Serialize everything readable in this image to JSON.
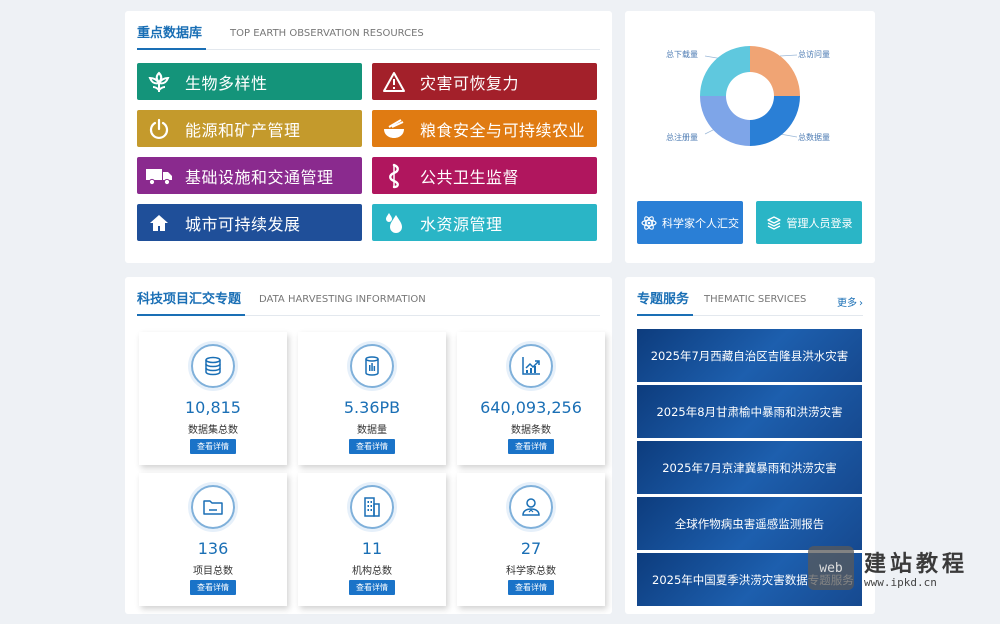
{
  "databases": {
    "title_cn": "重点数据库",
    "title_en": "TOP EARTH OBSERVATION RESOURCES",
    "items": [
      {
        "label": "生物多样性",
        "icon": "biodiversity-icon",
        "color": "#14947a"
      },
      {
        "label": "灾害可恢复力",
        "icon": "warning-icon",
        "color": "#a3202a"
      },
      {
        "label": "能源和矿产管理",
        "icon": "power-icon",
        "color": "#c49a2c"
      },
      {
        "label": "粮食安全与可持续农业",
        "icon": "bowl-icon",
        "color": "#e07b12"
      },
      {
        "label": "基础设施和交通管理",
        "icon": "truck-icon",
        "color": "#8a2a8e"
      },
      {
        "label": "公共卫生监督",
        "icon": "health-icon",
        "color": "#b0165e"
      },
      {
        "label": "城市可持续发展",
        "icon": "home-icon",
        "color": "#1f4f99"
      },
      {
        "label": "水资源管理",
        "icon": "water-drop-icon",
        "color": "#2ab5c6"
      }
    ]
  },
  "overview": {
    "chart_data": {
      "type": "pie",
      "categories": [
        "总访问量",
        "总数据量",
        "总注册量",
        "总下载量"
      ],
      "values": [
        25,
        25,
        25,
        25
      ],
      "colors": [
        "#f0a474",
        "#2a7fd6",
        "#7ea5e8",
        "#5fc8de"
      ]
    },
    "scientist_btn": "科学家个人汇交",
    "scientist_btn_color": "#2a7fd6",
    "admin_btn": "管理人员登录",
    "admin_btn_color": "#2ab5c6"
  },
  "projects": {
    "title_cn": "科技项目汇交专题",
    "title_en": "DATA HARVESTING INFORMATION",
    "view_label": "查看详情",
    "stats": [
      {
        "value": "10,815",
        "label": "数据集总数",
        "icon": "database-icon"
      },
      {
        "value": "5.36PB",
        "label": "数据量",
        "icon": "storage-icon"
      },
      {
        "value": "640,093,256",
        "label": "数据条数",
        "icon": "chart-icon"
      },
      {
        "value": "136",
        "label": "项目总数",
        "icon": "folder-icon"
      },
      {
        "value": "11",
        "label": "机构总数",
        "icon": "building-icon"
      },
      {
        "value": "27",
        "label": "科学家总数",
        "icon": "user-icon"
      }
    ]
  },
  "services": {
    "title_cn": "专题服务",
    "title_en": "THEMATIC SERVICES",
    "more": "更多",
    "items": [
      "2025年7月西藏自治区吉隆县洪水灾害",
      "2025年8月甘肃榆中暴雨和洪涝灾害",
      "2025年7月京津冀暴雨和洪涝灾害",
      "全球作物病虫害遥感监测报告",
      "2025年中国夏季洪涝灾害数据专题服务"
    ]
  },
  "watermark": {
    "logo": "web",
    "name": "建站教程",
    "url": "www.ipkd.cn"
  }
}
